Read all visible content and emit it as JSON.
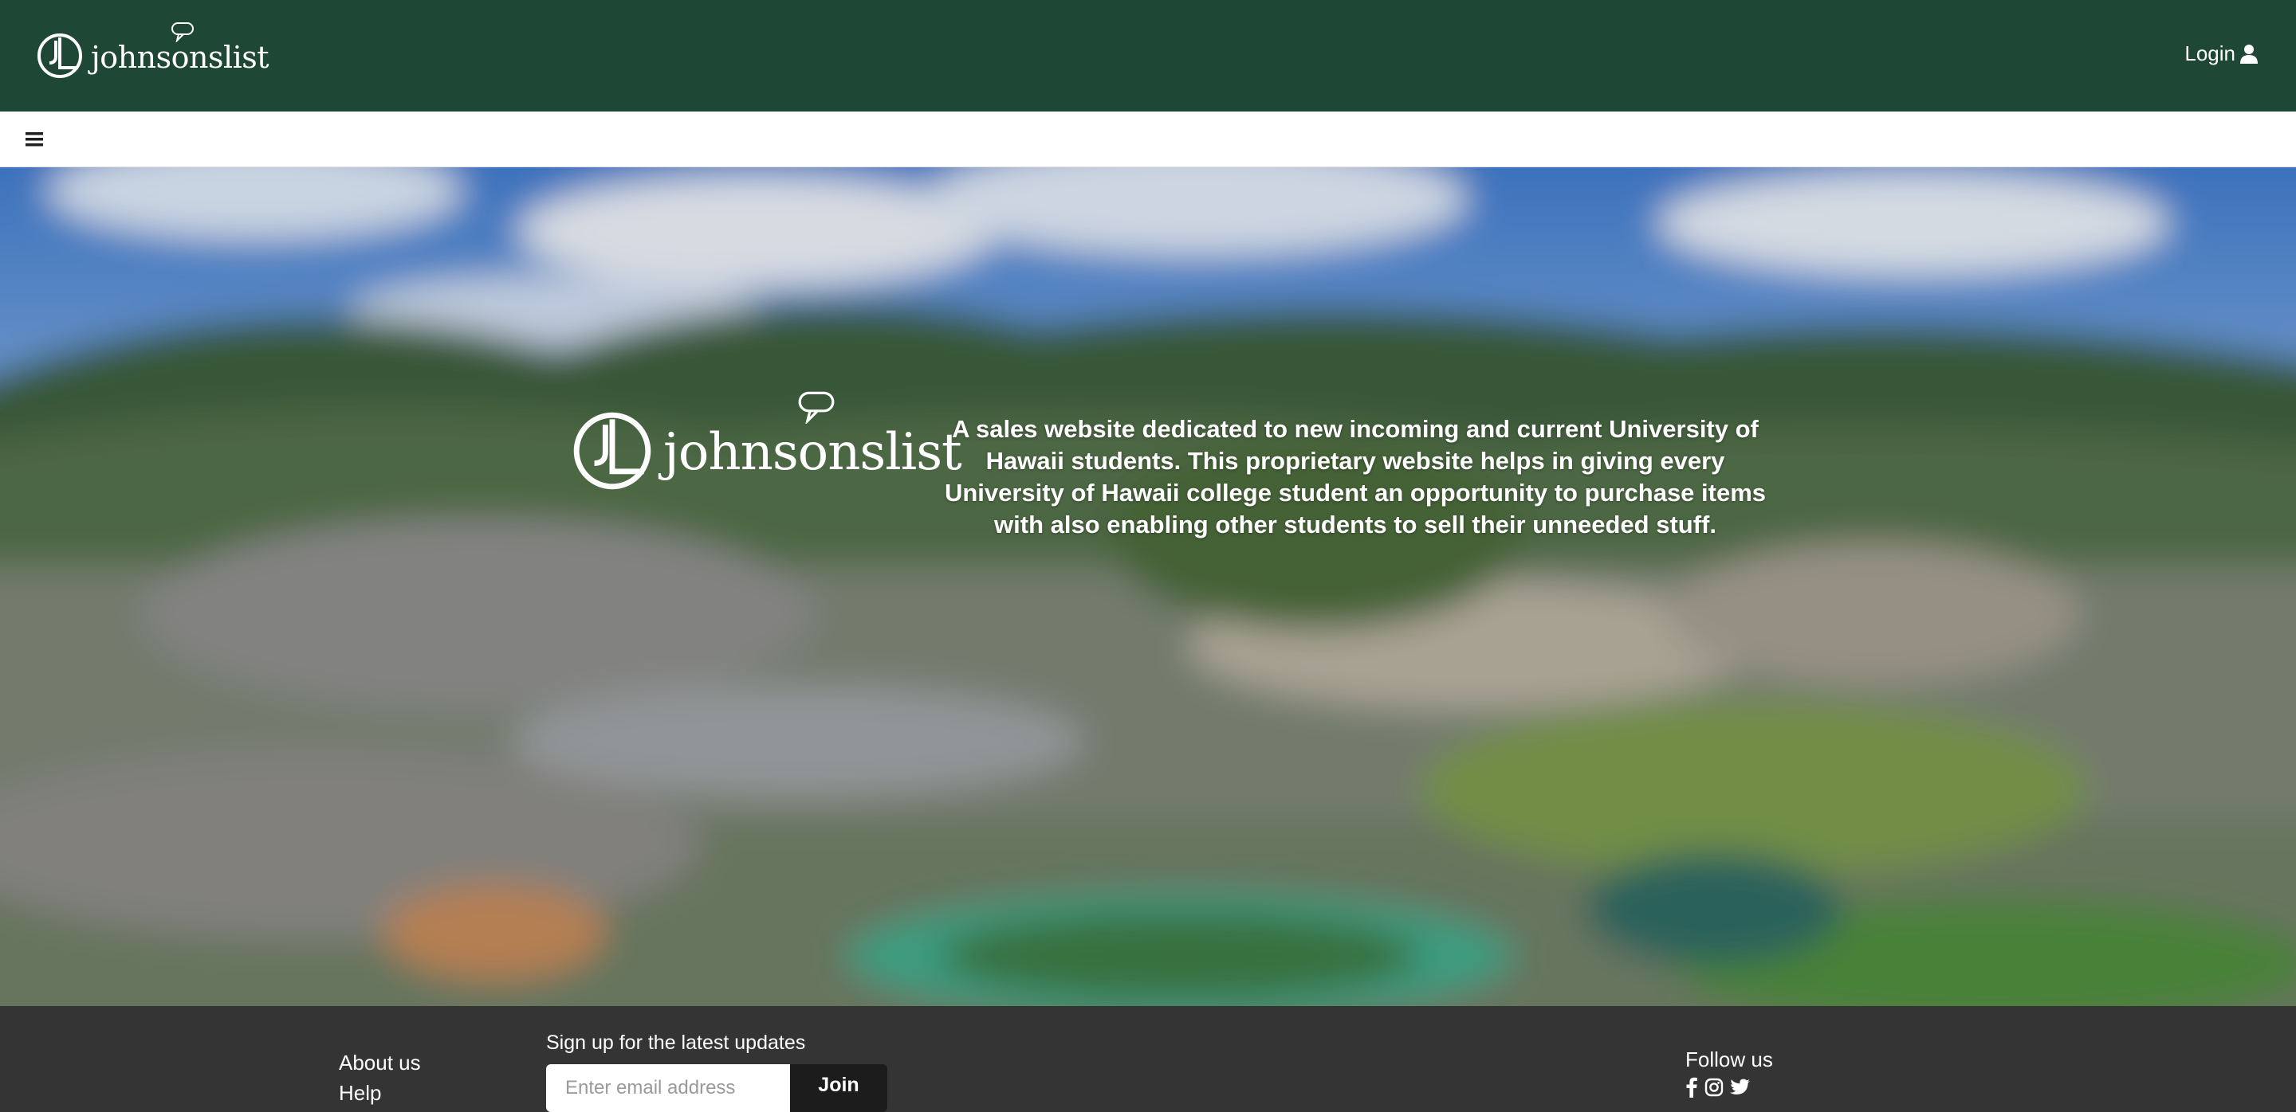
{
  "header": {
    "brand": "johnsonslist",
    "login_label": "Login",
    "colors": {
      "background": "#1f4736",
      "text": "#ffffff"
    }
  },
  "subnav": {
    "menu_icon": "hamburger-menu-icon"
  },
  "hero": {
    "logo_text": "johnsonslist",
    "description": "A sales website dedicated to new incoming and current University of Hawaii students. This proprietary website helps in giving every University of Hawaii college student an opportunity to purchase items with also enabling other students to sell their unneeded stuff."
  },
  "footer": {
    "links": [
      "About us",
      "Help"
    ],
    "signup": {
      "label": "Sign up for the latest updates",
      "placeholder": "Enter email address",
      "button": "Join"
    },
    "follow": {
      "label": "Follow us",
      "icons": [
        "facebook-icon",
        "instagram-icon",
        "twitter-icon"
      ]
    },
    "colors": {
      "background": "#343434"
    }
  }
}
